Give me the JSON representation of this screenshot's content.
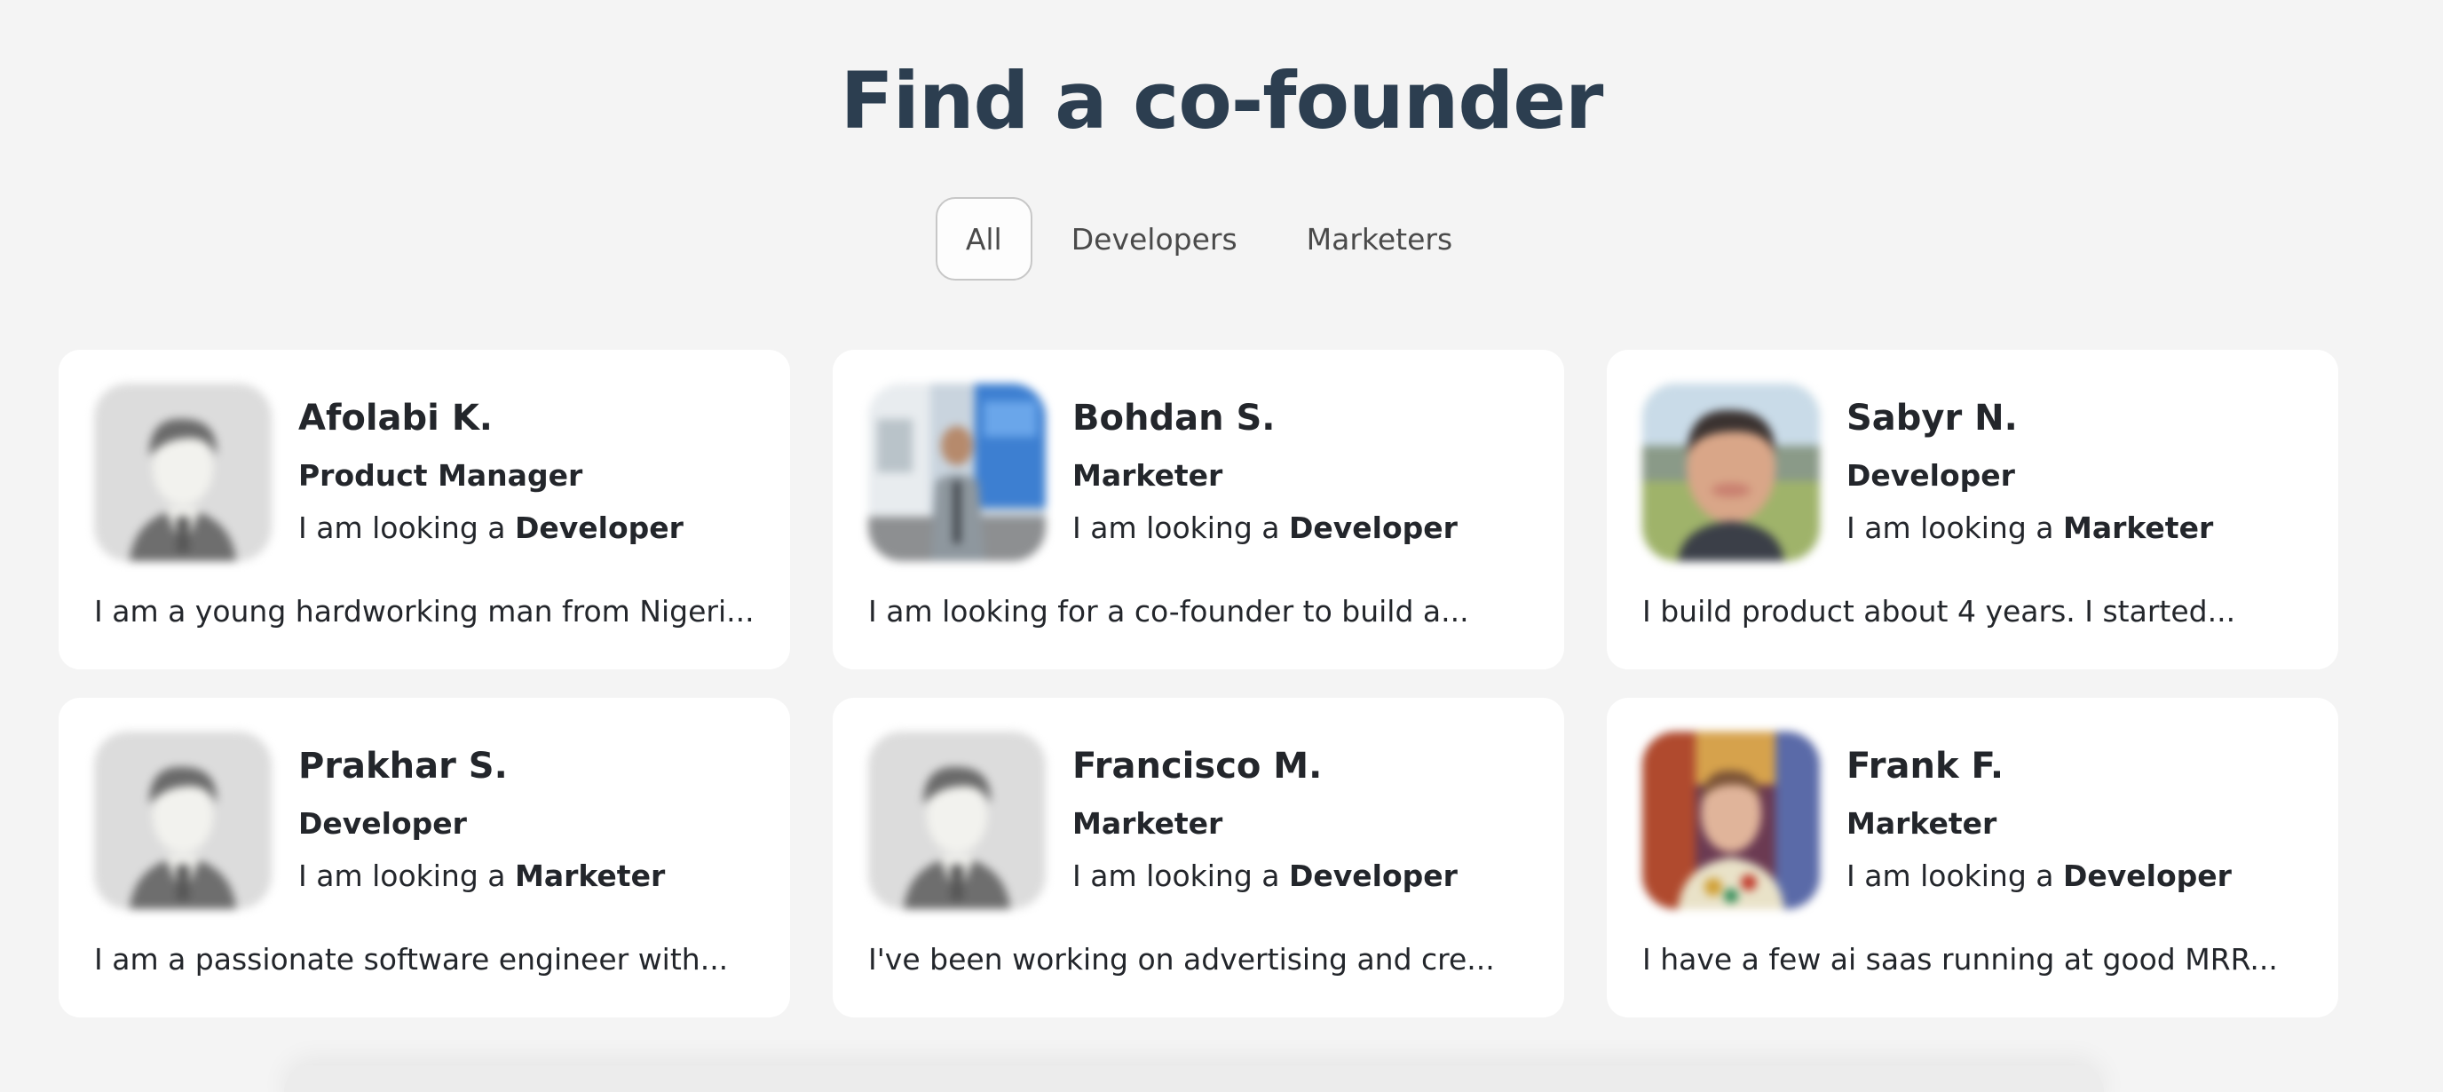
{
  "heading": "Find a co-founder",
  "tabs": [
    {
      "label": "All",
      "active": true
    },
    {
      "label": "Developers",
      "active": false
    },
    {
      "label": "Marketers",
      "active": false
    }
  ],
  "looking_prefix": "I am looking a",
  "profiles": [
    {
      "name": "Afolabi K.",
      "role": "Product Manager",
      "looking_for": "Developer",
      "bio": "I am a young hardworking man from Nigeri...",
      "avatar": "placeholder-person-icon"
    },
    {
      "name": "Bohdan S.",
      "role": "Marketer",
      "looking_for": "Developer",
      "bio": "I am looking for a co-founder to build a...",
      "avatar": "profile-photo"
    },
    {
      "name": "Sabyr N.",
      "role": "Developer",
      "looking_for": "Marketer",
      "bio": "I build product about 4 years. I started...",
      "avatar": "profile-photo"
    },
    {
      "name": "Prakhar S.",
      "role": "Developer",
      "looking_for": "Marketer",
      "bio": "I am a passionate software engineer with...",
      "avatar": "placeholder-person-icon"
    },
    {
      "name": "Francisco M.",
      "role": "Marketer",
      "looking_for": "Developer",
      "bio": "I've been working on advertising and cre...",
      "avatar": "placeholder-person-icon"
    },
    {
      "name": "Frank F.",
      "role": "Marketer",
      "looking_for": "Developer",
      "bio": "I have a few ai saas running at good MRR...",
      "avatar": "profile-photo"
    }
  ],
  "colors": {
    "background": "#f4f4f4",
    "card": "#ffffff",
    "heading": "#2c3e50",
    "text": "#23262b",
    "tab_active_border": "#c7c7c7"
  }
}
